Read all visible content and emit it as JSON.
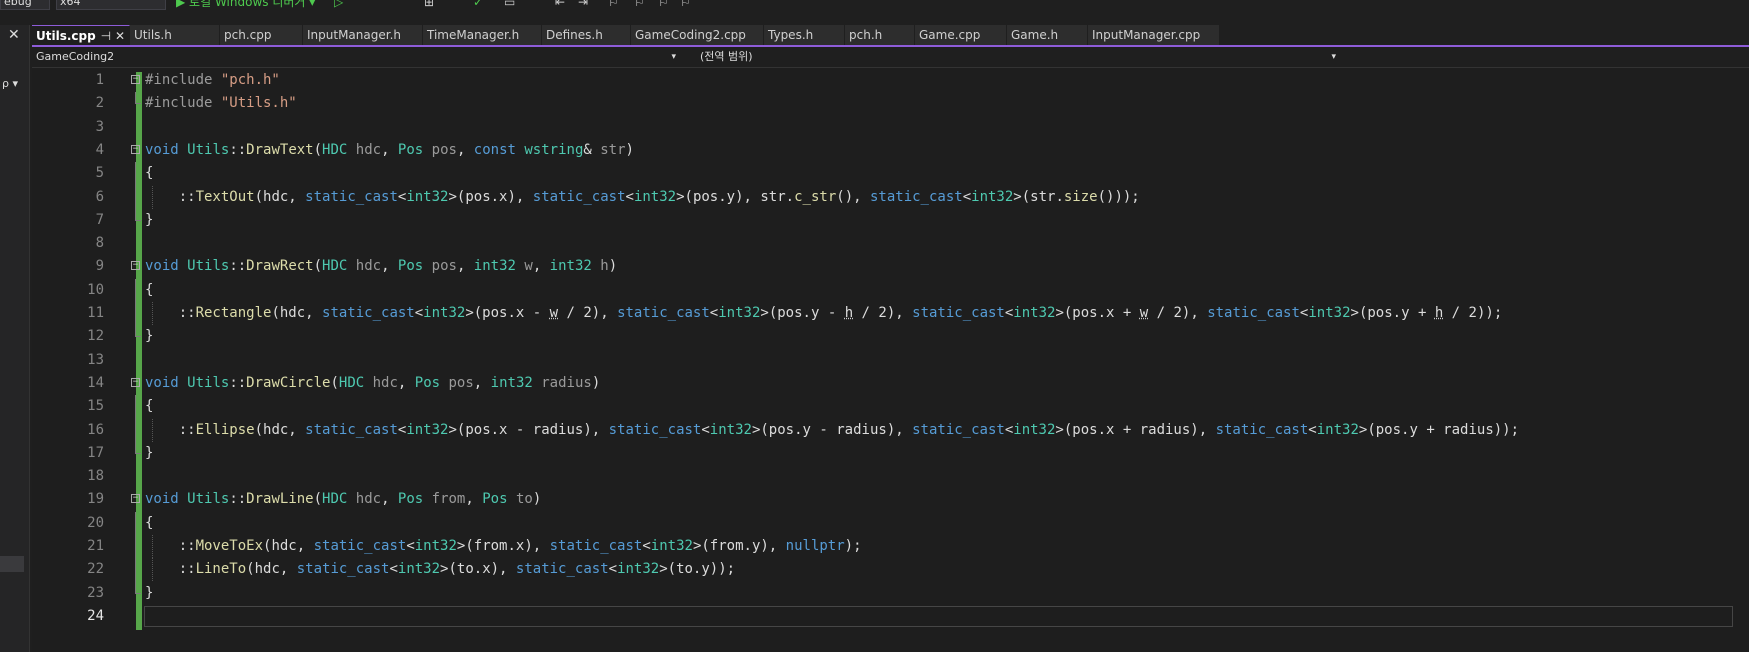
{
  "toolbar": {
    "configuration": "ebug",
    "platform": "x64",
    "run_label": "▶ 로컬 Windows 디버거 ▾"
  },
  "left_panel": {
    "close_glyph": "✕",
    "pin_glyph": "ρ ▾"
  },
  "tabs": [
    {
      "label": "Utils.cpp",
      "active": true,
      "pin": "⊣",
      "close": "✕"
    },
    {
      "label": "Utils.h"
    },
    {
      "label": "pch.cpp"
    },
    {
      "label": "InputManager.h"
    },
    {
      "label": "TimeManager.h"
    },
    {
      "label": "Defines.h"
    },
    {
      "label": "GameCoding2.cpp"
    },
    {
      "label": "Types.h"
    },
    {
      "label": "pch.h"
    },
    {
      "label": "Game.cpp"
    },
    {
      "label": "Game.h"
    },
    {
      "label": "InputManager.cpp"
    }
  ],
  "navbar": {
    "project": "GameCoding2",
    "scope": "(전역 범위)"
  },
  "editor": {
    "current_line": 24,
    "lines": [
      {
        "n": 1,
        "tokens": [
          [
            "pp",
            "#include "
          ],
          [
            "str",
            "\"pch.h\""
          ]
        ]
      },
      {
        "n": 2,
        "tokens": [
          [
            "pp",
            "#include "
          ],
          [
            "str",
            "\"Utils.h\""
          ]
        ]
      },
      {
        "n": 3,
        "tokens": []
      },
      {
        "n": 4,
        "tokens": [
          [
            "kw",
            "void "
          ],
          [
            "ty",
            "Utils"
          ],
          [
            "",
            "::"
          ],
          [
            "fn",
            "DrawText"
          ],
          [
            "",
            "("
          ],
          [
            "ty",
            "HDC"
          ],
          [
            "pm",
            " hdc"
          ],
          [
            "",
            ", "
          ],
          [
            "ty",
            "Pos"
          ],
          [
            "pm",
            " pos"
          ],
          [
            "",
            ", "
          ],
          [
            "kw",
            "const "
          ],
          [
            "ty",
            "wstring"
          ],
          [
            "",
            "& "
          ],
          [
            "pm",
            "str"
          ],
          [
            "",
            ")"
          ]
        ]
      },
      {
        "n": 5,
        "tokens": [
          [
            "",
            "{"
          ]
        ]
      },
      {
        "n": 6,
        "tokens": [
          [
            "",
            "    ::"
          ],
          [
            "fn",
            "TextOut"
          ],
          [
            "",
            "(hdc, "
          ],
          [
            "kw",
            "static_cast"
          ],
          [
            "",
            "<"
          ],
          [
            "ty",
            "int32"
          ],
          [
            "",
            ">(pos.x), "
          ],
          [
            "kw",
            "static_cast"
          ],
          [
            "",
            "<"
          ],
          [
            "ty",
            "int32"
          ],
          [
            "",
            ">(pos.y), str."
          ],
          [
            "fn",
            "c_str"
          ],
          [
            "",
            "(), "
          ],
          [
            "kw",
            "static_cast"
          ],
          [
            "",
            "<"
          ],
          [
            "ty",
            "int32"
          ],
          [
            "",
            ">(str."
          ],
          [
            "fn",
            "size"
          ],
          [
            "",
            "()));"
          ]
        ]
      },
      {
        "n": 7,
        "tokens": [
          [
            "",
            "}"
          ]
        ]
      },
      {
        "n": 8,
        "tokens": []
      },
      {
        "n": 9,
        "tokens": [
          [
            "kw",
            "void "
          ],
          [
            "ty",
            "Utils"
          ],
          [
            "",
            "::"
          ],
          [
            "fn",
            "DrawRect"
          ],
          [
            "",
            "("
          ],
          [
            "ty",
            "HDC"
          ],
          [
            "pm",
            " hdc"
          ],
          [
            "",
            ", "
          ],
          [
            "ty",
            "Pos"
          ],
          [
            "pm",
            " pos"
          ],
          [
            "",
            ", "
          ],
          [
            "ty",
            "int32"
          ],
          [
            "pm",
            " w"
          ],
          [
            "",
            ", "
          ],
          [
            "ty",
            "int32"
          ],
          [
            "pm",
            " h"
          ],
          [
            "",
            ")"
          ]
        ]
      },
      {
        "n": 10,
        "tokens": [
          [
            "",
            "{"
          ]
        ]
      },
      {
        "n": 11,
        "tokens": [
          [
            "",
            "    ::"
          ],
          [
            "fn",
            "Rectangle"
          ],
          [
            "",
            "(hdc, "
          ],
          [
            "kw",
            "static_cast"
          ],
          [
            "",
            "<"
          ],
          [
            "ty",
            "int32"
          ],
          [
            "",
            ">(pos.x - "
          ],
          [
            "sq",
            "w"
          ],
          [
            "",
            " / 2), "
          ],
          [
            "kw",
            "static_cast"
          ],
          [
            "",
            "<"
          ],
          [
            "ty",
            "int32"
          ],
          [
            "",
            ">(pos.y - "
          ],
          [
            "sq",
            "h"
          ],
          [
            "",
            " / 2), "
          ],
          [
            "kw",
            "static_cast"
          ],
          [
            "",
            "<"
          ],
          [
            "ty",
            "int32"
          ],
          [
            "",
            ">(pos.x + "
          ],
          [
            "sq",
            "w"
          ],
          [
            "",
            " / 2), "
          ],
          [
            "kw",
            "static_cast"
          ],
          [
            "",
            "<"
          ],
          [
            "ty",
            "int32"
          ],
          [
            "",
            ">(pos.y + "
          ],
          [
            "sq",
            "h"
          ],
          [
            "",
            " / 2));"
          ]
        ]
      },
      {
        "n": 12,
        "tokens": [
          [
            "",
            "}"
          ]
        ]
      },
      {
        "n": 13,
        "tokens": []
      },
      {
        "n": 14,
        "tokens": [
          [
            "kw",
            "void "
          ],
          [
            "ty",
            "Utils"
          ],
          [
            "",
            "::"
          ],
          [
            "fn",
            "DrawCircle"
          ],
          [
            "",
            "("
          ],
          [
            "ty",
            "HDC"
          ],
          [
            "pm",
            " hdc"
          ],
          [
            "",
            ", "
          ],
          [
            "ty",
            "Pos"
          ],
          [
            "pm",
            " pos"
          ],
          [
            "",
            ", "
          ],
          [
            "ty",
            "int32"
          ],
          [
            "pm",
            " radius"
          ],
          [
            "",
            ")"
          ]
        ]
      },
      {
        "n": 15,
        "tokens": [
          [
            "",
            "{"
          ]
        ]
      },
      {
        "n": 16,
        "tokens": [
          [
            "",
            "    ::"
          ],
          [
            "fn",
            "Ellipse"
          ],
          [
            "",
            "(hdc, "
          ],
          [
            "kw",
            "static_cast"
          ],
          [
            "",
            "<"
          ],
          [
            "ty",
            "int32"
          ],
          [
            "",
            ">(pos.x - radius), "
          ],
          [
            "kw",
            "static_cast"
          ],
          [
            "",
            "<"
          ],
          [
            "ty",
            "int32"
          ],
          [
            "",
            ">(pos.y - radius), "
          ],
          [
            "kw",
            "static_cast"
          ],
          [
            "",
            "<"
          ],
          [
            "ty",
            "int32"
          ],
          [
            "",
            ">(pos.x + radius), "
          ],
          [
            "kw",
            "static_cast"
          ],
          [
            "",
            "<"
          ],
          [
            "ty",
            "int32"
          ],
          [
            "",
            ">(pos.y + radius));"
          ]
        ]
      },
      {
        "n": 17,
        "tokens": [
          [
            "",
            "}"
          ]
        ]
      },
      {
        "n": 18,
        "tokens": []
      },
      {
        "n": 19,
        "tokens": [
          [
            "kw",
            "void "
          ],
          [
            "ty",
            "Utils"
          ],
          [
            "",
            "::"
          ],
          [
            "fn",
            "DrawLine"
          ],
          [
            "",
            "("
          ],
          [
            "ty",
            "HDC"
          ],
          [
            "pm",
            " hdc"
          ],
          [
            "",
            ", "
          ],
          [
            "ty",
            "Pos"
          ],
          [
            "pm",
            " from"
          ],
          [
            "",
            ", "
          ],
          [
            "ty",
            "Pos"
          ],
          [
            "pm",
            " to"
          ],
          [
            "",
            ")"
          ]
        ]
      },
      {
        "n": 20,
        "tokens": [
          [
            "",
            "{"
          ]
        ]
      },
      {
        "n": 21,
        "tokens": [
          [
            "",
            "    ::"
          ],
          [
            "fn",
            "MoveToEx"
          ],
          [
            "",
            "(hdc, "
          ],
          [
            "kw",
            "static_cast"
          ],
          [
            "",
            "<"
          ],
          [
            "ty",
            "int32"
          ],
          [
            "",
            ">(from.x), "
          ],
          [
            "kw",
            "static_cast"
          ],
          [
            "",
            "<"
          ],
          [
            "ty",
            "int32"
          ],
          [
            "",
            ">(from.y), "
          ],
          [
            "kw",
            "nullptr"
          ],
          [
            "",
            ");"
          ]
        ]
      },
      {
        "n": 22,
        "tokens": [
          [
            "",
            "    ::"
          ],
          [
            "fn",
            "LineTo"
          ],
          [
            "",
            "(hdc, "
          ],
          [
            "kw",
            "static_cast"
          ],
          [
            "",
            "<"
          ],
          [
            "ty",
            "int32"
          ],
          [
            "",
            ">(to.x), "
          ],
          [
            "kw",
            "static_cast"
          ],
          [
            "",
            "<"
          ],
          [
            "ty",
            "int32"
          ],
          [
            "",
            ">(to.y));"
          ]
        ]
      },
      {
        "n": 23,
        "tokens": [
          [
            "",
            "}"
          ]
        ]
      },
      {
        "n": 24,
        "tokens": []
      }
    ]
  },
  "colors": {
    "keyword": "#569cd6",
    "type": "#4ec9b0",
    "function": "#dcdcaa",
    "string": "#d69d85",
    "change_bar": "#57a64a",
    "tab_accent": "#8e5cd9"
  }
}
